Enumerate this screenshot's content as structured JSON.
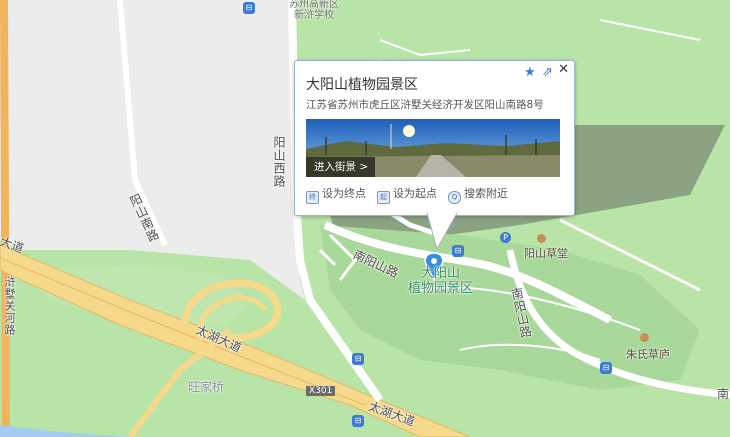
{
  "map": {
    "roads": {
      "yangshan_xi": "阳山西路",
      "yangshan_nan": "阳山南路",
      "nanyangshan": "南阳山路",
      "taihu_1": "太湖大道",
      "taihu_2": "太湖大道",
      "da_dao": "大道",
      "nanyang_vert": "南阳山路",
      "route": "X301",
      "left_vert": "浒墅关河路",
      "edge_e": "南"
    },
    "pois": {
      "school": "苏州高新区\n新浒学校",
      "bridge": "旺家桥",
      "yangshan_hall": "阳山草堂",
      "zhu_house": "朱氏草庐",
      "scenic_bg": "大阳山\n植物园景区",
      "scenic_small": "阳山南路"
    },
    "bus_glyph": "⊟"
  },
  "popup": {
    "title": "大阳山植物园景区",
    "address": "江苏省苏州市虎丘区浒墅关经济开发区阳山南路8号",
    "streetview_label": "进入街景 >",
    "actions": {
      "set_end": "设为终点",
      "set_start": "设为起点",
      "search_nearby": "搜索附近"
    },
    "close_glyph": "✕",
    "star_glyph": "★",
    "share_glyph": "⇗"
  },
  "colors": {
    "green": "#b9e4a8",
    "road_yellow": "#f6d98a",
    "marker_blue": "#2f8fe0"
  }
}
